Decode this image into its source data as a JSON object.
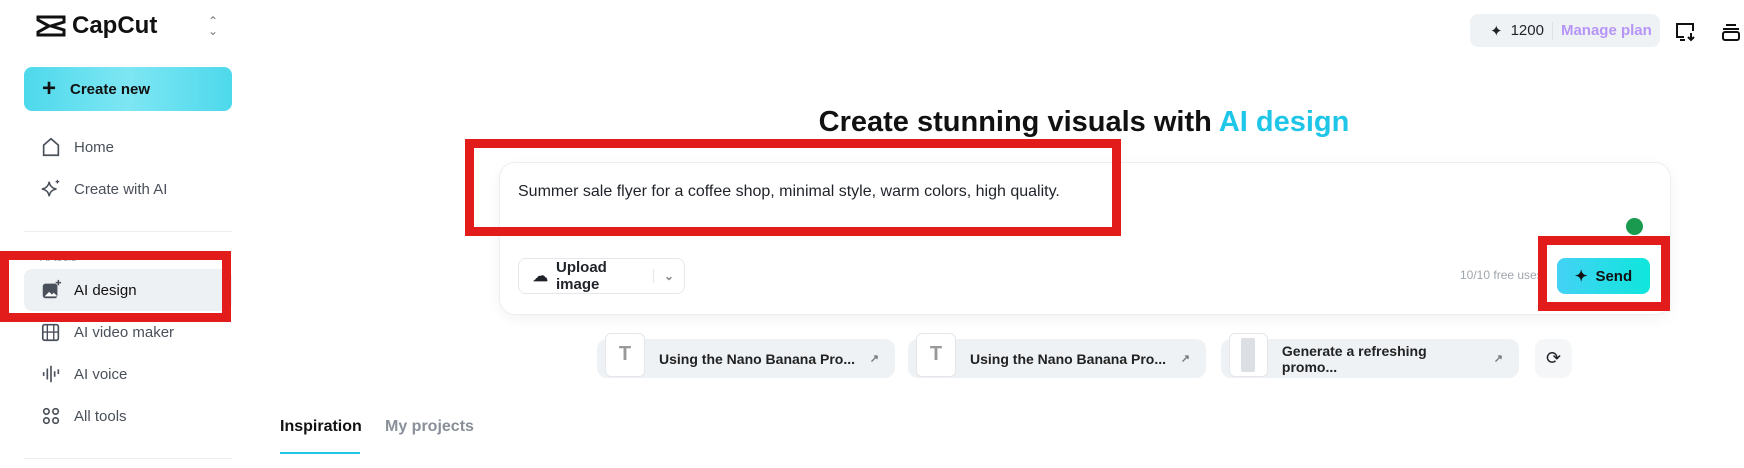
{
  "sidebar": {
    "brand": "CapCut",
    "create_new": "Create new",
    "items": [
      {
        "label": "Home"
      },
      {
        "label": "Create with AI"
      }
    ],
    "section_label": "AI tools",
    "tools": [
      {
        "label": "AI design"
      },
      {
        "label": "AI video maker"
      },
      {
        "label": "AI voice"
      },
      {
        "label": "All tools"
      }
    ]
  },
  "header": {
    "credits": "1200",
    "manage_plan": "Manage plan"
  },
  "main": {
    "heading_prefix": "Create stunning visuals with ",
    "heading_accent": "AI design",
    "prompt": "Summer sale flyer for a coffee shop, minimal style, warm colors, high quality.",
    "upload_label": "Upload image",
    "free_uses": "10/10 free uses",
    "send_label": "Send",
    "suggestions": [
      {
        "label": "Using the Nano Banana Pro..."
      },
      {
        "label": "Using the Nano Banana Pro..."
      },
      {
        "label": "Generate a refreshing promo..."
      }
    ],
    "tabs": [
      {
        "label": "Inspiration"
      },
      {
        "label": "My projects"
      }
    ]
  },
  "colors": {
    "accent": "#1fc6e8",
    "highlight": "#e21b1b",
    "manage_plan": "#b695f7"
  }
}
